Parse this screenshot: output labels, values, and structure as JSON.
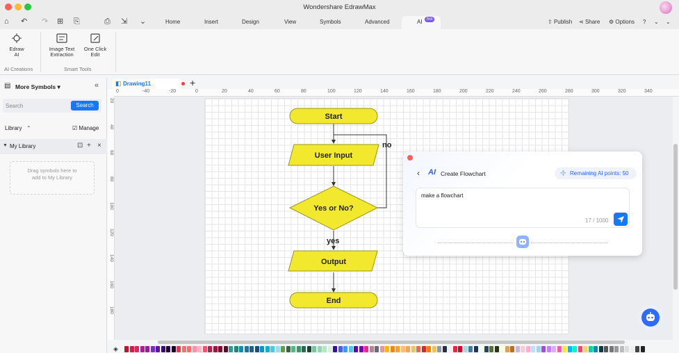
{
  "window": {
    "title": "Wondershare EdrawMax"
  },
  "colors": {
    "accent": "#1677ff",
    "shape_fill": "#f2e92f",
    "shape_stroke": "#9a9616",
    "hot_badge": "#7a56f6"
  },
  "menu": {
    "tabs": [
      "Home",
      "Insert",
      "Design",
      "View",
      "Symbols",
      "Advanced"
    ],
    "ai_tab": {
      "label": "AI",
      "badge": "hot"
    },
    "publish": "Publish",
    "share": "Share",
    "options": "Options"
  },
  "ribbon": {
    "edraw_ai": {
      "label_line1": "Edraw",
      "label_line2": "AI"
    },
    "text_extraction": {
      "label_line1": "Image Text",
      "label_line2": "Extraction"
    },
    "one_click_edit": {
      "label_line1": "One Click",
      "label_line2": "Edit"
    },
    "groups": {
      "ai_creations": "AI Creations",
      "smart_tools": "Smart Tools"
    }
  },
  "left_panel": {
    "title": "More Symbols",
    "search": {
      "placeholder": "Search",
      "button": "Search"
    },
    "library_label": "Library",
    "manage_label": "Manage",
    "my_library": "My Library",
    "drop_hint": "Drag symbols here to add to My Library"
  },
  "doc_tab": {
    "name": "Drawing11"
  },
  "ruler": {
    "h_ticks": [
      "0",
      "-40",
      "-20",
      "0",
      "20",
      "40",
      "60",
      "80",
      "100",
      "120",
      "140",
      "160",
      "180",
      "200",
      "220",
      "240",
      "260",
      "280",
      "300",
      "320",
      "340"
    ],
    "v_ticks": [
      "20",
      "40",
      "60",
      "80",
      "100",
      "120",
      "140",
      "160",
      "180"
    ]
  },
  "flowchart": {
    "start": "Start",
    "input": "User Input",
    "decision": "Yes or No?",
    "output": "Output",
    "end": "End",
    "label_no": "no",
    "label_yes": "yes"
  },
  "ai_popup": {
    "title": "Create Flowchart",
    "ai_logo": "AI",
    "remaining_points": "Remaining AI points: 50",
    "prompt_value": "make a flowchart",
    "char_count": "17 / 1000"
  },
  "icons": {
    "home": "home-icon",
    "undo": "undo-icon",
    "redo": "redo-icon",
    "new": "new-page-icon",
    "save": "save-icon",
    "print": "print-icon",
    "export": "export-icon",
    "more": "more-icon",
    "publish": "publish-icon",
    "share": "share-icon",
    "options": "gear-icon",
    "help": "help-icon"
  },
  "palette": [
    "#c8102e",
    "#d81b45",
    "#e0245e",
    "#b5179e",
    "#9b1d9b",
    "#7b2cbf",
    "#5a189a",
    "#3c096c",
    "#240046",
    "#10002b",
    "#e63946",
    "#f07167",
    "#ff6b6b",
    "#ff8fab",
    "#ffb3c1",
    "#ff4d6d",
    "#c9184a",
    "#a4133c",
    "#800f2f",
    "#590d22",
    "#2a9d8f",
    "#21867a",
    "#168aad",
    "#1a759f",
    "#1e6091",
    "#184e77",
    "#0096c7",
    "#00b4d8",
    "#48cae4",
    "#90e0ef",
    "#6a994e",
    "#386641",
    "#52b788",
    "#40916c",
    "#2d6a4f",
    "#1b4332",
    "#74c69d",
    "#95d5b2",
    "#b7e4c7",
    "#d8f3dc",
    "#3a0ca3",
    "#4361ee",
    "#4895ef",
    "#4cc9f0",
    "#560bad",
    "#7209b7",
    "#f72585",
    "#b5838d",
    "#6d6875",
    "#e5989b",
    "#ffb703",
    "#fb8500",
    "#ff9f1c",
    "#ffbf69",
    "#f4a261",
    "#e9c46a",
    "#e76f51",
    "#d62828",
    "#f77f00",
    "#fcbf49",
    "#8d99ae",
    "#2b2d42",
    "#edf2f4",
    "#ef233c",
    "#d90429",
    "#a8dadc",
    "#457b9d",
    "#1d3557",
    "#f1faee",
    "#264653",
    "#606c38",
    "#283618",
    "#fefae0",
    "#dda15e",
    "#bc6c25",
    "#cdb4db",
    "#ffc8dd",
    "#ffafcc",
    "#bde0fe",
    "#a2d2ff",
    "#9d4edd",
    "#c77dff",
    "#e0aaff",
    "#f15bb5",
    "#fee440",
    "#00bbf9",
    "#00f5d4",
    "#ef476f",
    "#ffd166",
    "#06d6a0",
    "#118ab2",
    "#073b4c",
    "#555555",
    "#777777",
    "#999999",
    "#bbbbbb",
    "#dddddd",
    "#eeeeee",
    "#444444",
    "#222222"
  ]
}
